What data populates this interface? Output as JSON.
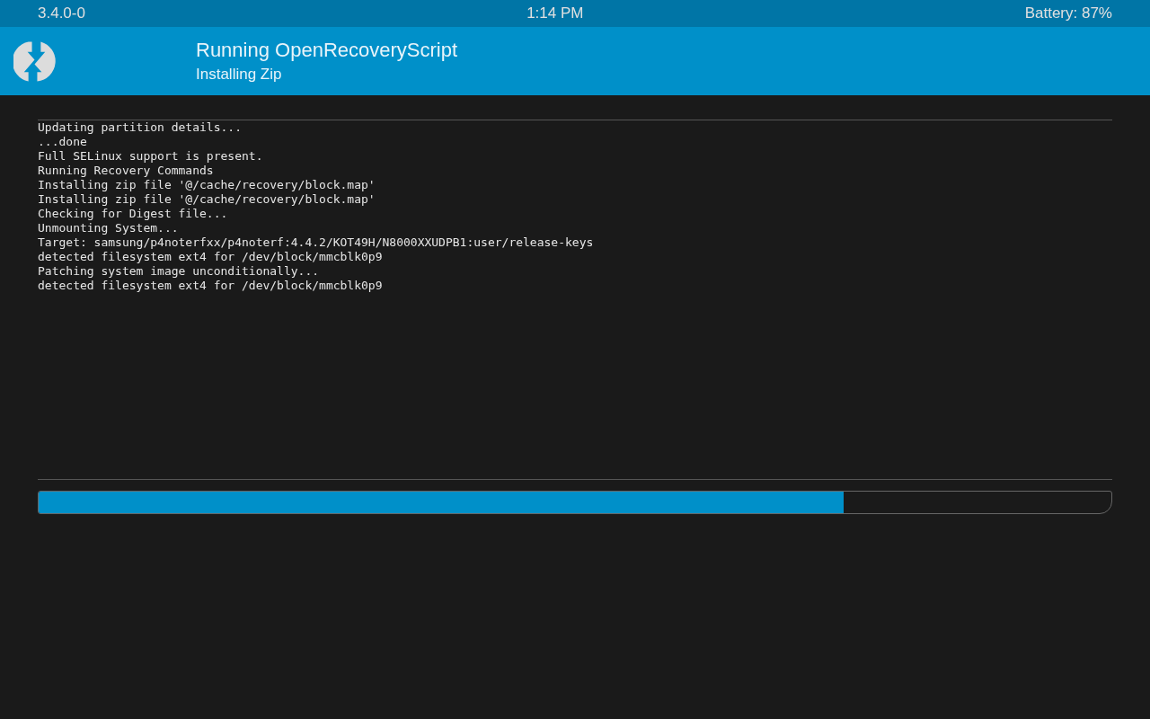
{
  "status_bar": {
    "version": "3.4.0-0",
    "time": "1:14 PM",
    "battery": "Battery: 87%"
  },
  "header": {
    "title": "Running OpenRecoveryScript",
    "subtitle": "Installing Zip"
  },
  "console": {
    "lines": [
      "Updating partition details...",
      "...done",
      "Full SELinux support is present.",
      "Running Recovery Commands",
      "Installing zip file '@/cache/recovery/block.map'",
      "Installing zip file '@/cache/recovery/block.map'",
      "Checking for Digest file...",
      "Unmounting System...",
      "Target: samsung/p4noterfxx/p4noterf:4.4.2/KOT49H/N8000XXUDPB1:user/release-keys",
      "detected filesystem ext4 for /dev/block/mmcblk0p9",
      "Patching system image unconditionally...",
      "detected filesystem ext4 for /dev/block/mmcblk0p9"
    ]
  },
  "progress": {
    "level": 0.75
  }
}
